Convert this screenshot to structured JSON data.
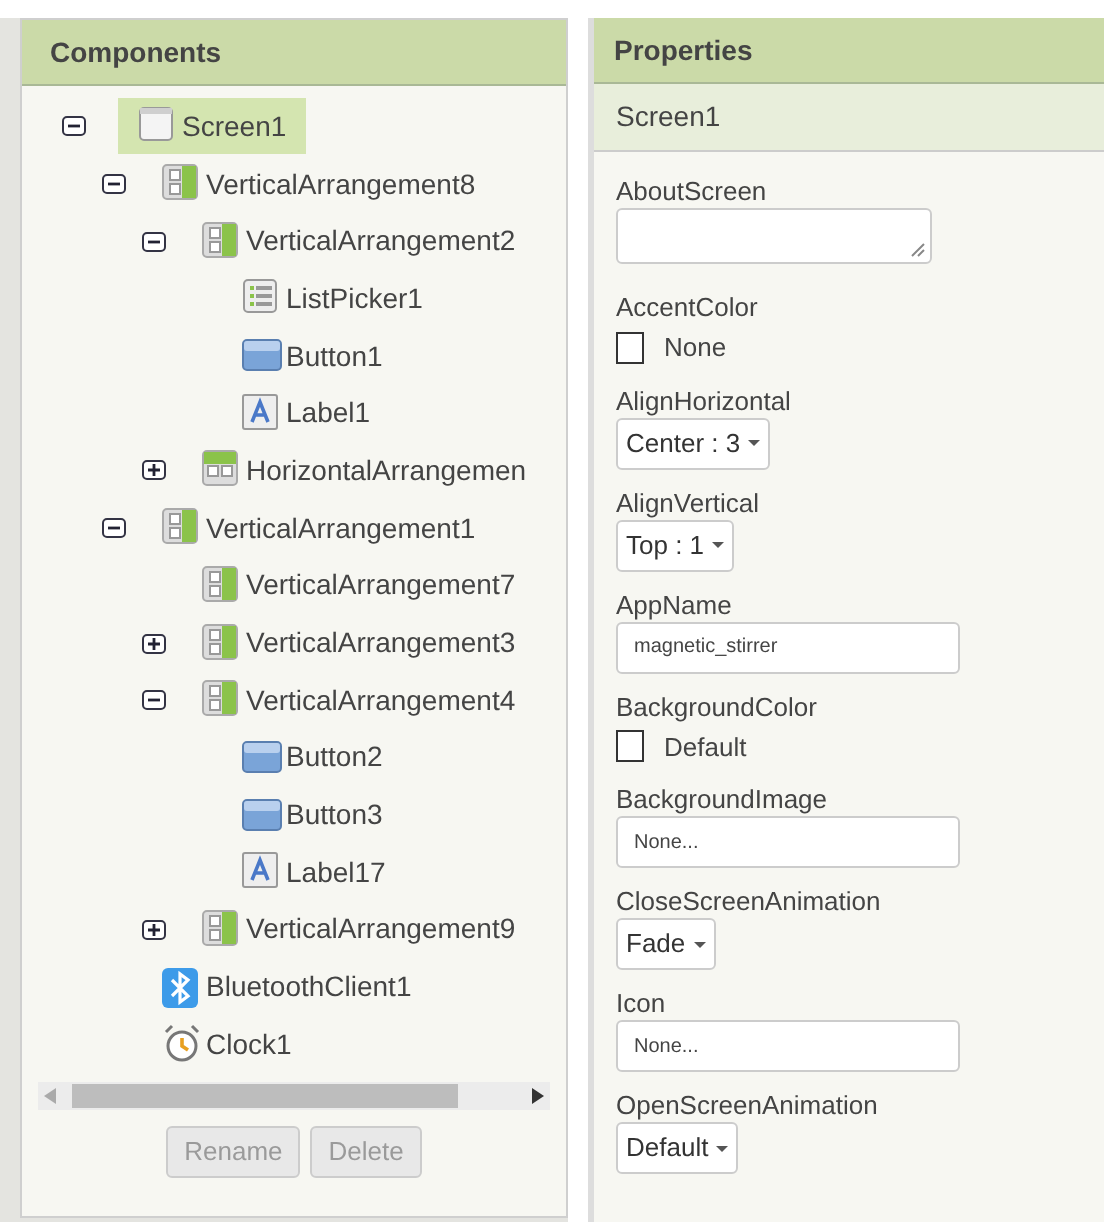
{
  "components": {
    "title": "Components",
    "tree": [
      {
        "name": "Screen1",
        "kind": "screen",
        "selected": true,
        "expanded": true,
        "children": [
          {
            "name": "VerticalArrangement8",
            "kind": "vertical",
            "selected": false,
            "expanded": true,
            "children": [
              {
                "name": "VerticalArrangement2",
                "kind": "vertical",
                "selected": false,
                "expanded": true,
                "children": [
                  {
                    "name": "ListPicker1",
                    "kind": "listpicker",
                    "selected": false
                  },
                  {
                    "name": "Button1",
                    "kind": "button",
                    "selected": false
                  },
                  {
                    "name": "Label1",
                    "kind": "label",
                    "selected": false
                  }
                ]
              },
              {
                "name": "HorizontalArrangemen",
                "kind": "horizontal",
                "selected": false,
                "expanded": false
              }
            ]
          },
          {
            "name": "VerticalArrangement1",
            "kind": "vertical",
            "selected": false,
            "expanded": true,
            "children": [
              {
                "name": "VerticalArrangement7",
                "kind": "vertical",
                "selected": false
              },
              {
                "name": "VerticalArrangement3",
                "kind": "vertical",
                "selected": false,
                "expanded": false
              },
              {
                "name": "VerticalArrangement4",
                "kind": "vertical",
                "selected": false,
                "expanded": true,
                "children": [
                  {
                    "name": "Button2",
                    "kind": "button",
                    "selected": false
                  },
                  {
                    "name": "Button3",
                    "kind": "button",
                    "selected": false
                  },
                  {
                    "name": "Label17",
                    "kind": "label",
                    "selected": false
                  }
                ]
              },
              {
                "name": "VerticalArrangement9",
                "kind": "vertical",
                "selected": false,
                "expanded": false
              }
            ]
          },
          {
            "name": "BluetoothClient1",
            "kind": "bluetooth",
            "selected": false
          },
          {
            "name": "Clock1",
            "kind": "clock",
            "selected": false
          }
        ]
      }
    ],
    "buttons": [
      {
        "label": "Rename",
        "disabled": true
      },
      {
        "label": "Delete",
        "disabled": true
      }
    ]
  },
  "properties": {
    "title": "Properties",
    "component": "Screen1",
    "items": [
      {
        "label": "AboutScreen",
        "kind": "textarea"
      },
      {
        "label": "AccentColor",
        "kind": "color",
        "value": "None"
      },
      {
        "label": "AlignHorizontal",
        "kind": "dropdown",
        "value": "Center : 3"
      },
      {
        "label": "AlignVertical",
        "kind": "dropdown",
        "value": "Top : 1"
      },
      {
        "label": "AppName",
        "kind": "text",
        "value": "magnetic_stirrer"
      },
      {
        "label": "BackgroundColor",
        "kind": "color",
        "value": "Default"
      },
      {
        "label": "BackgroundImage",
        "kind": "text",
        "value": "None..."
      },
      {
        "label": "CloseScreenAnimation",
        "kind": "dropdown",
        "value": "Fade"
      },
      {
        "label": "Icon",
        "kind": "text",
        "value": "None..."
      },
      {
        "label": "OpenScreenAnimation",
        "kind": "dropdown",
        "value": "Default"
      }
    ]
  }
}
